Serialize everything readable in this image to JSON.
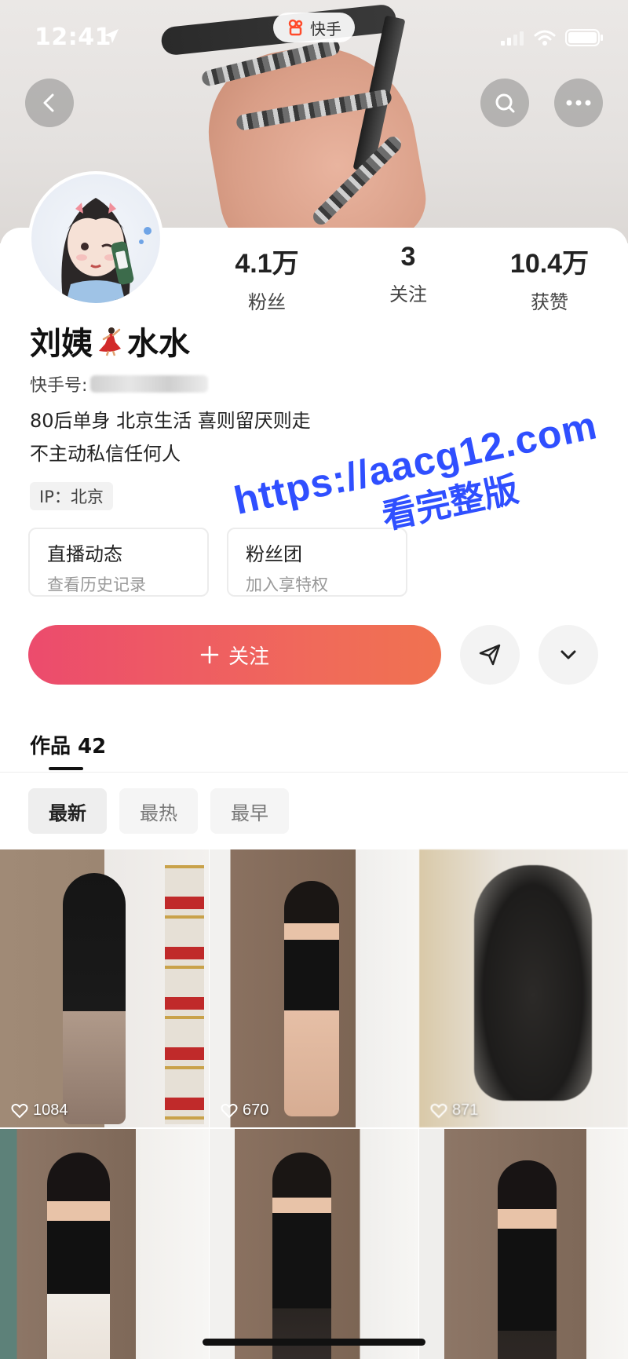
{
  "status_bar": {
    "time": "12:41"
  },
  "app_badge": {
    "label": "快手"
  },
  "profile": {
    "name_part1": "刘姨",
    "name_part2": "水水",
    "kuaishou_id_label": "快手号:",
    "bio_line1": "80后单身 北京生活 喜则留厌则走",
    "bio_line2": "不主动私信任何人",
    "ip_label": "IP：北京"
  },
  "stats": [
    {
      "value": "4.1万",
      "label": "粉丝"
    },
    {
      "value": "3",
      "label": "关注"
    },
    {
      "value": "10.4万",
      "label": "获赞"
    }
  ],
  "cards": [
    {
      "title": "直播动态",
      "subtitle": "查看历史记录"
    },
    {
      "title": "粉丝团",
      "subtitle": "加入享特权"
    }
  ],
  "actions": {
    "follow_label": "关注",
    "follow_icon": "plus-icon"
  },
  "works_tab": {
    "label": "作品 42"
  },
  "filters": [
    "最新",
    "最热",
    "最早"
  ],
  "grid": [
    {
      "likes": "1084"
    },
    {
      "likes": "670"
    },
    {
      "likes": "871"
    },
    {
      "likes": ""
    },
    {
      "likes": ""
    },
    {
      "likes": ""
    }
  ],
  "watermark": {
    "line1": "https://aacg12.com",
    "line2": "看完整版"
  },
  "colors": {
    "follow_gradient_start": "#ec4b6d",
    "follow_gradient_end": "#f07250",
    "watermark": "#2f4fff"
  }
}
